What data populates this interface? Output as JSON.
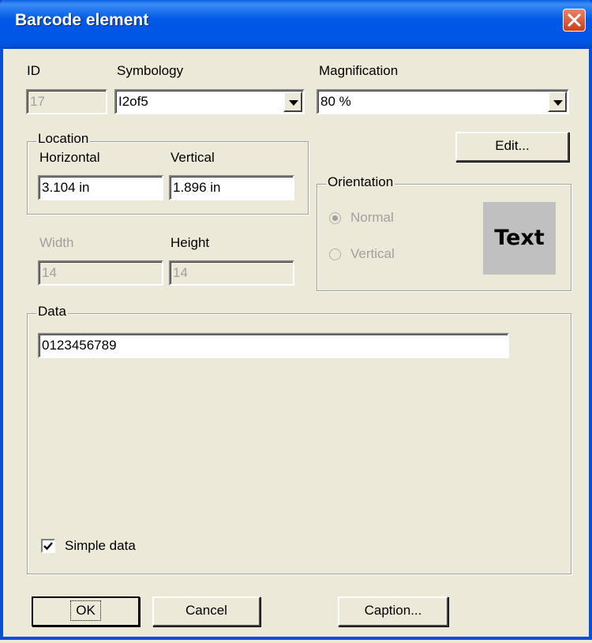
{
  "window": {
    "title": "Barcode element"
  },
  "fields": {
    "id": {
      "label": "ID",
      "value": "17"
    },
    "symbology": {
      "label": "Symbology",
      "value": "I2of5"
    },
    "magnification": {
      "label": "Magnification",
      "value": "80 %"
    }
  },
  "location": {
    "group_label": "Location",
    "horizontal_label": "Horizontal",
    "horizontal_value": "3.104 in",
    "vertical_label": "Vertical",
    "vertical_value": "1.896 in"
  },
  "size": {
    "width_label": "Width",
    "width_value": "14",
    "height_label": "Height",
    "height_value": "14"
  },
  "edit_button": "Edit...",
  "orientation": {
    "group_label": "Orientation",
    "options": [
      "Normal",
      "Vertical"
    ],
    "selected": "Normal",
    "preview_text": "Text"
  },
  "data_group": {
    "label": "Data",
    "value": "0123456789",
    "simple_data_label": "Simple data",
    "simple_data_checked": true
  },
  "buttons": {
    "ok": "OK",
    "cancel": "Cancel",
    "caption": "Caption..."
  }
}
